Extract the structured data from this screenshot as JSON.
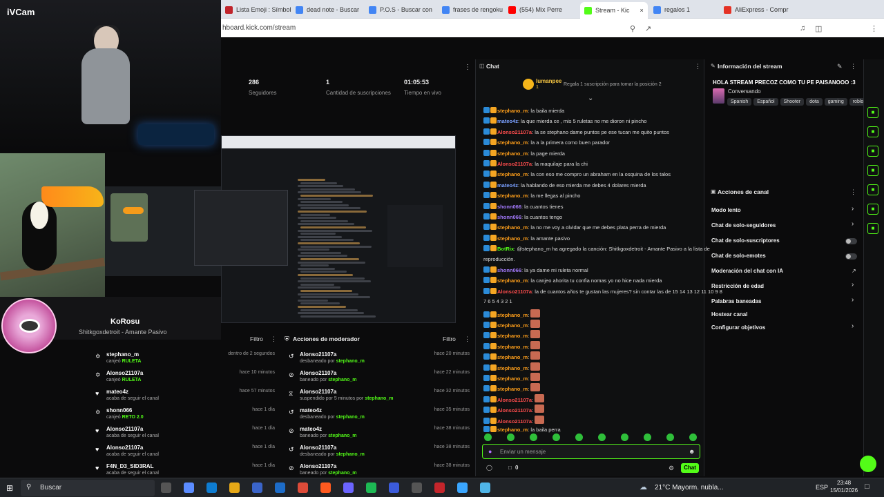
{
  "camera": {
    "label": "iVCam"
  },
  "browser": {
    "tabs": [
      {
        "label": "Lista Emoji : Símbol",
        "color": "#c0242b"
      },
      {
        "label": "dead note - Buscar",
        "color": "#4285f4"
      },
      {
        "label": "P.O.S - Buscar con",
        "color": "#4285f4"
      },
      {
        "label": "frases de rengoku",
        "color": "#4285f4"
      },
      {
        "label": "(554) Mix Perre",
        "color": "#ff0000"
      },
      {
        "label": "Stream - Kic",
        "color": "#53fc18"
      },
      {
        "label": "regalos 1",
        "color": "#4285f4"
      },
      {
        "label": "AliExpress - Compr",
        "color": "#e43225"
      }
    ],
    "url": "hboard.kick.com/stream"
  },
  "streamer": {
    "name": "KoRosu",
    "song": "Shitkgoxdetroit - Amante Pasivo"
  },
  "stats": [
    {
      "value": "286",
      "label": "Seguidores"
    },
    {
      "value": "1",
      "label": "Cantidad de suscripciones"
    },
    {
      "value": "01:05:53",
      "label": "Tiempo en vivo"
    }
  ],
  "activity": {
    "filter": "Filtro",
    "rows": [
      {
        "icon": "gift-icon",
        "name": "stephano_m",
        "desc": "canjeó",
        "highlight": "RULETA",
        "time": "dentro de 2 segundos"
      },
      {
        "icon": "gift-icon",
        "name": "Alonso21107a",
        "desc": "canjeó",
        "highlight": "RULETA",
        "time": "hace 10 minutos"
      },
      {
        "icon": "heart-icon",
        "name": "mateo4z",
        "desc": "acaba de seguir el canal",
        "highlight": "",
        "time": "hace 57 minutos"
      },
      {
        "icon": "gift-icon",
        "name": "shonn066",
        "desc": "canjeó",
        "highlight": "RETO 2.0",
        "time": "hace 1 día"
      },
      {
        "icon": "heart-icon",
        "name": "Alonso21107a",
        "desc": "acaba de seguir el canal",
        "highlight": "",
        "time": "hace 1 día"
      },
      {
        "icon": "heart-icon",
        "name": "Alonso21107a",
        "desc": "acaba de seguir el canal",
        "highlight": "",
        "time": "hace 1 día"
      },
      {
        "icon": "heart-icon",
        "name": "F4N_D3_SID3RAL",
        "desc": "acaba de seguir el canal",
        "highlight": "",
        "time": "hace 1 día"
      }
    ]
  },
  "modactions": {
    "title": "Acciones de moderador",
    "filter": "Filtro",
    "rows": [
      {
        "icon": "undo-icon",
        "name": "Alonso21107a",
        "desc": "desbaneado por",
        "by": "stephano_m",
        "time": "hace 20 minutos"
      },
      {
        "icon": "ban-icon",
        "name": "Alonso21107a",
        "desc": "baneado por",
        "by": "stephano_m",
        "time": "hace 22 minutos"
      },
      {
        "icon": "hourglass-icon",
        "name": "Alonso21107a",
        "desc": "suspendido por 5 minutos por",
        "by": "stephano_m",
        "time": "hace 32 minutos"
      },
      {
        "icon": "undo-icon",
        "name": "mateo4z",
        "desc": "desbaneado por",
        "by": "stephano_m",
        "time": "hace 35 minutos"
      },
      {
        "icon": "ban-icon",
        "name": "mateo4z",
        "desc": "baneado por",
        "by": "stephano_m",
        "time": "hace 38 minutos"
      },
      {
        "icon": "undo-icon",
        "name": "Alonso21107a",
        "desc": "desbaneado por",
        "by": "stephano_m",
        "time": "hace 38 minutos"
      },
      {
        "icon": "ban-icon",
        "name": "Alonso21107a",
        "desc": "baneado por",
        "by": "stephano_m",
        "time": "hace 38 minutos"
      }
    ]
  },
  "chat": {
    "title": "Chat",
    "pinned_user": "lumanpee",
    "pinned_count": "1",
    "pinned_note": "Regala 1 suscripción para tomar la posición 2",
    "messages": [
      {
        "user": "stephano_m",
        "color": "#ff9f1a",
        "text": ": la baila mierda"
      },
      {
        "user": "mateo4z",
        "color": "#7aa0ff",
        "text": ": la que mierda ce , mis 5 ruletas no me dioron ni pincho"
      },
      {
        "user": "Alonso21107a",
        "color": "#ff4d4d",
        "text": ": la se stephano dame puntos pe ese tucan me quito puntos"
      },
      {
        "user": "stephano_m",
        "color": "#ff9f1a",
        "text": ": la a la primera como buen parador"
      },
      {
        "user": "stephano_m",
        "color": "#ff9f1a",
        "text": ": la page mierda"
      },
      {
        "user": "Alonso21107a",
        "color": "#ff4d4d",
        "text": ": la maquilaje para la chi"
      },
      {
        "user": "stephano_m",
        "color": "#ff9f1a",
        "text": ": la con eso me compro un abraham en la osquina de los talos"
      },
      {
        "user": "mateo4z",
        "color": "#7aa0ff",
        "text": ": la hablando de eso mierda me debes 4 dolares mierda"
      },
      {
        "user": "stephano_m",
        "color": "#ff9f1a",
        "text": ": la me llegas al pincho"
      },
      {
        "user": "shonn066",
        "color": "#a57bff",
        "text": ": la cuantos tienes"
      },
      {
        "user": "shonn066",
        "color": "#a57bff",
        "text": ": la cuantos tengo"
      },
      {
        "user": "stephano_m",
        "color": "#ff9f1a",
        "text": ": la no me voy a olvidar que me debes plata perra de mierda"
      },
      {
        "user": "stephano_m",
        "color": "#ff9f1a",
        "text": ": la amante pasivo"
      },
      {
        "user": "BotRix",
        "color": "#53fc18",
        "text": ": @stephano_m ha agregado la canción: Shitkgoxdetroit - Amante Pasivo a la lista de"
      },
      {
        "user": "",
        "color": "#ddd",
        "text": "reproducción."
      },
      {
        "user": "shonn066",
        "color": "#a57bff",
        "text": ": la ya dame mi ruleta normal"
      },
      {
        "user": "stephano_m",
        "color": "#ff9f1a",
        "text": ": la canjeo ahorita tu confia nomas yo no hice nada mierda"
      },
      {
        "user": "Alonso21107a",
        "color": "#ff4d4d",
        "text": ": la de cuantos años te gustan las mujeres? sin contar las de 15 14 13 12 11 10 9 8"
      },
      {
        "user": "",
        "color": "#ddd",
        "text": "7 6 5 4 3 2 1"
      },
      {
        "user": "stephano_m",
        "color": "#ff9f1a",
        "text": ":"
      },
      {
        "user": "stephano_m",
        "color": "#ff9f1a",
        "text": ":"
      },
      {
        "user": "stephano_m",
        "color": "#ff9f1a",
        "text": ":"
      },
      {
        "user": "stephano_m",
        "color": "#ff9f1a",
        "text": ":"
      },
      {
        "user": "stephano_m",
        "color": "#ff9f1a",
        "text": ":"
      },
      {
        "user": "stephano_m",
        "color": "#ff9f1a",
        "text": ":"
      },
      {
        "user": "stephano_m",
        "color": "#ff9f1a",
        "text": ":"
      },
      {
        "user": "stephano_m",
        "color": "#ff9f1a",
        "text": ":"
      },
      {
        "user": "Alonso21107a",
        "color": "#ff4d4d",
        "text": ":"
      },
      {
        "user": "Alonso21107a",
        "color": "#ff4d4d",
        "text": ":"
      },
      {
        "user": "Alonso21107a",
        "color": "#ff4d4d",
        "text": ":"
      },
      {
        "user": "stephano_m",
        "color": "#ff9f1a",
        "text": ": la baila perra"
      }
    ],
    "placeholder": "Enviar un mensaje",
    "send_label": "Chat",
    "viewer_count": "0"
  },
  "stream_info": {
    "header": "Información del stream",
    "title": "HOLA STREAM PRECOZ COMO TU PE PAISANOOO :3",
    "category": "Conversando",
    "tags": [
      "Spanish",
      "Español",
      "Shooter",
      "dota",
      "gaming",
      "roblox"
    ]
  },
  "channel_actions": {
    "header": "Acciones de canal",
    "items": [
      {
        "label": "Modo lento",
        "control": "chevron"
      },
      {
        "label": "Chat de solo-seguidores",
        "control": "chevron"
      },
      {
        "label": "Chat de solo-suscriptores",
        "control": "toggle"
      },
      {
        "label": "Chat de solo-emotes",
        "control": "toggle"
      },
      {
        "label": "Moderación del chat con IA",
        "control": "external"
      },
      {
        "label": "Restricción de edad",
        "control": "chevron"
      },
      {
        "label": "Palabras baneadas",
        "control": "chevron"
      },
      {
        "label": "Hostear canal",
        "control": "none"
      },
      {
        "label": "Configurar objetivos",
        "control": "chevron"
      }
    ]
  },
  "taskbar": {
    "search": "Buscar",
    "weather": "21°C  Mayorm. nubla...",
    "lang": "ESP",
    "time": "23:48",
    "date": "15/01/2026"
  },
  "colors": {
    "accent": "#53fc18",
    "bg": "#0b0b0c"
  }
}
